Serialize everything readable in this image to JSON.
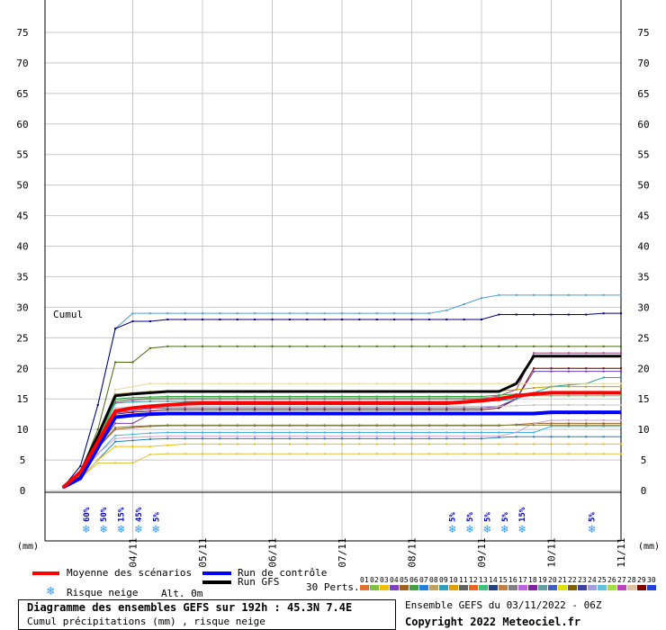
{
  "chart_data": {
    "type": "line",
    "y_tick_labels": [
      "0",
      "5",
      "10",
      "15",
      "20",
      "25",
      "30",
      "35",
      "40",
      "45",
      "50",
      "55",
      "60",
      "65",
      "70",
      "75"
    ],
    "ylim": [
      0,
      75
    ],
    "y_label_left": "(mm)",
    "y_label_right": "(mm)",
    "annotation": "Cumul",
    "x_dates": [
      "04/11",
      "05/11",
      "06/11",
      "07/11",
      "08/11",
      "09/11",
      "10/11",
      "11/11"
    ],
    "x_hours": [
      0,
      6,
      12,
      18,
      24,
      30,
      36,
      42,
      48,
      54,
      60,
      66,
      72,
      78,
      84,
      90,
      96,
      102,
      108,
      114,
      120,
      126,
      132,
      138,
      144,
      150,
      156,
      162,
      168,
      174,
      180,
      186,
      192
    ],
    "series": [
      {
        "name": "Moyenne des scénarios",
        "color": "#ff0000",
        "width": 4,
        "values": [
          0.5,
          3,
          8,
          13,
          13.5,
          13.8,
          14,
          14.2,
          14.3,
          14.3,
          14.3,
          14.3,
          14.3,
          14.3,
          14.3,
          14.3,
          14.3,
          14.3,
          14.3,
          14.3,
          14.3,
          14.3,
          14.3,
          14.5,
          14.7,
          15,
          15.5,
          15.8,
          16,
          16,
          16,
          16,
          16
        ]
      },
      {
        "name": "Run de contrôle",
        "color": "#0000ff",
        "width": 4,
        "values": [
          0.5,
          2,
          7,
          12,
          12.3,
          12.5,
          12.6,
          12.6,
          12.6,
          12.6,
          12.6,
          12.6,
          12.6,
          12.6,
          12.6,
          12.6,
          12.6,
          12.6,
          12.6,
          12.6,
          12.6,
          12.6,
          12.6,
          12.6,
          12.6,
          12.6,
          12.6,
          12.6,
          12.8,
          12.8,
          12.8,
          12.8,
          12.8
        ]
      },
      {
        "name": "Run GFS",
        "color": "#000000",
        "width": 3,
        "values": [
          0.5,
          3,
          9,
          15.5,
          15.8,
          16,
          16.2,
          16.2,
          16.2,
          16.2,
          16.2,
          16.2,
          16.2,
          16.2,
          16.2,
          16.2,
          16.2,
          16.2,
          16.2,
          16.2,
          16.2,
          16.2,
          16.2,
          16.2,
          16.2,
          16.2,
          17.5,
          22,
          22,
          22,
          22,
          22,
          22
        ]
      }
    ],
    "members": [
      {
        "color": "#4f9fd0",
        "values": [
          0.5,
          4,
          14,
          26.5,
          29,
          29,
          29,
          29,
          29,
          29,
          29,
          29,
          29,
          29,
          29,
          29,
          29,
          29,
          29,
          29,
          29,
          29,
          29.5,
          30.5,
          31.5,
          32,
          32,
          32,
          32,
          32,
          32,
          32,
          32
        ]
      },
      {
        "color": "#000080",
        "values": [
          0.5,
          4,
          14,
          26.5,
          27.7,
          27.7,
          28,
          28,
          28,
          28,
          28,
          28,
          28,
          28,
          28,
          28,
          28,
          28,
          28,
          28,
          28,
          28,
          28,
          28,
          28,
          28.8,
          28.8,
          28.8,
          28.8,
          28.8,
          28.8,
          29,
          29
        ]
      },
      {
        "color": "#4a6a10",
        "values": [
          0.5,
          3,
          10,
          21,
          21,
          23.3,
          23.6,
          23.6,
          23.6,
          23.6,
          23.6,
          23.6,
          23.6,
          23.6,
          23.6,
          23.6,
          23.6,
          23.6,
          23.6,
          23.6,
          23.6,
          23.6,
          23.6,
          23.6,
          23.6,
          23.6,
          23.6,
          23.6,
          23.6,
          23.6,
          23.6,
          23.6,
          23.6
        ]
      },
      {
        "color": "#a04080",
        "values": [
          0.5,
          3,
          9,
          14.5,
          14.8,
          15,
          15,
          15,
          15,
          15,
          15,
          15,
          15,
          15,
          15,
          15,
          15,
          15,
          15,
          15,
          15,
          15,
          15,
          15,
          15,
          15.5,
          16.5,
          22.5,
          22.5,
          22.5,
          22.5,
          22.5,
          22.5
        ]
      },
      {
        "color": "#800000",
        "values": [
          0.5,
          3,
          8,
          12.5,
          12.8,
          13,
          13.2,
          13.2,
          13.2,
          13.2,
          13.2,
          13.2,
          13.2,
          13.2,
          13.2,
          13.2,
          13.2,
          13.2,
          13.2,
          13.2,
          13.2,
          13.2,
          13.2,
          13.2,
          13.2,
          13.5,
          15,
          20,
          20,
          20,
          20,
          20,
          20
        ]
      },
      {
        "color": "#6040c0",
        "values": [
          0.5,
          3,
          8,
          12.7,
          13,
          13.4,
          13.5,
          13.5,
          13.5,
          13.5,
          13.5,
          13.5,
          13.5,
          13.5,
          13.5,
          13.5,
          13.5,
          13.5,
          13.5,
          13.5,
          13.5,
          13.5,
          13.5,
          13.5,
          13.5,
          13.8,
          15,
          19.5,
          19.5,
          19.5,
          19.5,
          19.5,
          19.5
        ]
      },
      {
        "color": "#20a0a0",
        "values": [
          0.5,
          3,
          8,
          14.3,
          14.5,
          14.6,
          14.6,
          14.6,
          14.6,
          14.6,
          14.6,
          14.6,
          14.6,
          14.6,
          14.6,
          14.6,
          14.6,
          14.6,
          14.6,
          14.6,
          14.6,
          14.6,
          14.6,
          14.6,
          14.6,
          14.7,
          15,
          16,
          17,
          17.3,
          17.5,
          18.5,
          18.5
        ]
      },
      {
        "color": "#c0a000",
        "values": [
          0.5,
          3,
          7,
          15.8,
          16,
          16.2,
          16.3,
          16.3,
          16.3,
          16.3,
          16.3,
          16.3,
          16.3,
          16.3,
          16.3,
          16.3,
          16.3,
          16.3,
          16.3,
          16.3,
          16.3,
          16.3,
          16.3,
          16.3,
          16.3,
          16.3,
          16.5,
          16.8,
          17,
          17,
          17,
          17,
          17
        ]
      },
      {
        "color": "#e8d8a0",
        "values": [
          0.5,
          3,
          8,
          16.5,
          17,
          17.5,
          17.5,
          17.5,
          17.5,
          17.5,
          17.5,
          17.5,
          17.5,
          17.5,
          17.5,
          17.5,
          17.5,
          17.5,
          17.5,
          17.5,
          17.5,
          17.5,
          17.5,
          17.5,
          17.5,
          17.5,
          17.5,
          17.5,
          17.5,
          17.5,
          17.5,
          17.5,
          17.5
        ]
      },
      {
        "color": "#30a040",
        "values": [
          0.5,
          3,
          8,
          15,
          15.2,
          15.3,
          15.4,
          15.4,
          15.4,
          15.4,
          15.4,
          15.4,
          15.4,
          15.4,
          15.4,
          15.4,
          15.4,
          15.4,
          15.4,
          15.4,
          15.4,
          15.4,
          15.4,
          15.4,
          15.4,
          15.6,
          15.8,
          15.8,
          15.8,
          15.8,
          15.8,
          15.8,
          15.8
        ]
      },
      {
        "color": "#60c060",
        "values": [
          0.5,
          3,
          8,
          14.8,
          15,
          15.1,
          15.2,
          15.2,
          15.2,
          15.2,
          15.2,
          15.2,
          15.2,
          15.2,
          15.2,
          15.2,
          15.2,
          15.2,
          15.2,
          15.2,
          15.2,
          15.2,
          15.2,
          15.2,
          15.2,
          15.3,
          15.5,
          15.5,
          15.5,
          15.5,
          15.5,
          15.5,
          15.5
        ]
      },
      {
        "color": "#c0c0c0",
        "values": [
          0.5,
          3,
          8,
          13.5,
          13.7,
          13.8,
          13.8,
          13.8,
          13.8,
          13.8,
          13.8,
          13.8,
          13.8,
          13.8,
          13.8,
          13.8,
          13.8,
          13.8,
          13.8,
          13.8,
          13.8,
          13.8,
          13.8,
          13.8,
          13.8,
          13.8,
          13.9,
          14,
          14,
          14,
          14,
          14,
          14
        ]
      },
      {
        "color": "#a06020",
        "values": [
          0.5,
          2.5,
          7,
          10,
          10.3,
          10.5,
          10.6,
          10.6,
          10.6,
          10.6,
          10.6,
          10.6,
          10.6,
          10.6,
          10.6,
          10.6,
          10.6,
          10.6,
          10.6,
          10.6,
          10.6,
          10.6,
          10.6,
          10.6,
          10.6,
          10.6,
          10.8,
          11,
          11,
          11,
          11,
          11,
          11
        ]
      },
      {
        "color": "#8040a0",
        "values": [
          0.5,
          2.5,
          7,
          11,
          11,
          12.5,
          12.6,
          12.6,
          12.6,
          12.6,
          12.6,
          12.6,
          12.6,
          12.6,
          12.6,
          12.6,
          12.6,
          12.6,
          12.6,
          12.6,
          12.6,
          12.6,
          12.6,
          12.6,
          12.6,
          12.6,
          12.6,
          12.6,
          12.6,
          12.6,
          12.6,
          12.6,
          12.6
        ]
      },
      {
        "color": "#40b0e0",
        "values": [
          0.5,
          2.5,
          6,
          9,
          9.2,
          9.4,
          9.5,
          9.5,
          9.5,
          9.5,
          9.5,
          9.5,
          9.5,
          9.5,
          9.5,
          9.5,
          9.5,
          9.5,
          9.5,
          9.5,
          9.5,
          9.5,
          9.5,
          9.5,
          9.5,
          9.5,
          9.5,
          9.5,
          10.5,
          10.5,
          10.5,
          10.5,
          10.5
        ]
      },
      {
        "color": "#d0a0d0",
        "values": [
          0.5,
          2.5,
          6,
          8.5,
          8.7,
          8.8,
          8.9,
          8.9,
          8.9,
          8.9,
          8.9,
          8.9,
          8.9,
          8.9,
          8.9,
          8.9,
          8.9,
          8.9,
          8.9,
          8.9,
          8.9,
          8.9,
          8.9,
          8.9,
          8.9,
          8.9,
          9.5,
          11,
          11.5,
          11.5,
          11.5,
          11.5,
          11.5
        ]
      },
      {
        "color": "#2080c0",
        "values": [
          0.5,
          2,
          5,
          8,
          8.2,
          8.4,
          8.5,
          8.5,
          8.5,
          8.5,
          8.5,
          8.5,
          8.5,
          8.5,
          8.5,
          8.5,
          8.5,
          8.5,
          8.5,
          8.5,
          8.5,
          8.5,
          8.5,
          8.5,
          8.5,
          8.7,
          8.8,
          8.8,
          8.8,
          8.8,
          8.8,
          8.8,
          8.8
        ]
      },
      {
        "color": "#f0c000",
        "values": [
          0.5,
          2,
          5,
          7.2,
          7.2,
          7.2,
          7.4,
          7.6,
          7.6,
          7.6,
          7.6,
          7.6,
          7.6,
          7.6,
          7.6,
          7.6,
          7.6,
          7.6,
          7.6,
          7.6,
          7.6,
          7.6,
          7.6,
          7.6,
          7.6,
          7.6,
          7.6,
          7.6,
          7.6,
          7.6,
          7.6,
          7.6,
          7.6
        ]
      },
      {
        "color": "#e0c040",
        "values": [
          0.5,
          2,
          4.5,
          4.5,
          4.5,
          5.9,
          6,
          6,
          6,
          6,
          6,
          6,
          6,
          6,
          6,
          6,
          6,
          6,
          6,
          6,
          6,
          6,
          6,
          6,
          6,
          6,
          6,
          6,
          6,
          6,
          6,
          6,
          6
        ]
      },
      {
        "color": "#808040",
        "values": [
          0.5,
          2.5,
          7,
          10.3,
          10.5,
          10.6,
          10.7,
          10.7,
          10.7,
          10.7,
          10.7,
          10.7,
          10.7,
          10.7,
          10.7,
          10.7,
          10.7,
          10.7,
          10.7,
          10.7,
          10.7,
          10.7,
          10.7,
          10.7,
          10.7,
          10.7,
          10.7,
          10.7,
          10.7,
          10.7,
          10.7,
          10.7,
          10.7
        ]
      }
    ],
    "snow_markers": [
      {
        "date_hour": 8,
        "pct": "60%"
      },
      {
        "date_hour": 14,
        "pct": "50%"
      },
      {
        "date_hour": 20,
        "pct": "15%"
      },
      {
        "date_hour": 26,
        "pct": "45%"
      },
      {
        "date_hour": 32,
        "pct": "5%"
      },
      {
        "date_hour": 134,
        "pct": "5%"
      },
      {
        "date_hour": 140,
        "pct": "5%"
      },
      {
        "date_hour": 146,
        "pct": "5%"
      },
      {
        "date_hour": 152,
        "pct": "5%"
      },
      {
        "date_hour": 158,
        "pct": "15%"
      },
      {
        "date_hour": 182,
        "pct": "5%"
      }
    ]
  },
  "legend": {
    "mean_label": "Moyenne des scénarios",
    "control_label": "Run de contrôle",
    "gfs_label": "Run GFS",
    "snow_label": "Risque neige",
    "alt_label": "Alt. 0m",
    "perts_label": "30 Perts.",
    "member_numbers": [
      "01",
      "02",
      "03",
      "04",
      "05",
      "06",
      "07",
      "08",
      "09",
      "10",
      "11",
      "12",
      "13",
      "14",
      "15",
      "16",
      "17",
      "18",
      "19",
      "20",
      "21",
      "22",
      "23",
      "24",
      "25",
      "26",
      "27",
      "28",
      "29",
      "30"
    ],
    "member_colors": [
      "#e07030",
      "#80c040",
      "#f0c000",
      "#8040c0",
      "#a06020",
      "#40a040",
      "#2080e0",
      "#c0a060",
      "#30a0c0",
      "#e0a000",
      "#606060",
      "#f06020",
      "#40c080",
      "#204080",
      "#c08040",
      "#808080",
      "#c060e0",
      "#8020a0",
      "#60a0a0",
      "#4060c0",
      "#e0e000",
      "#806000",
      "#4040a0",
      "#a0a0e0",
      "#60c0e0",
      "#a0e040",
      "#c040c0",
      "#e0c0a0",
      "#800000",
      "#2040e0"
    ]
  },
  "footer": {
    "title": "Diagramme des ensembles GEFS sur 192h : 45.3N 7.4E",
    "subtitle": "Cumul précipitations (mm) , risque neige",
    "run": "Ensemble GEFS du 03/11/2022 - 06Z",
    "copyright": "Copyright 2022 Meteociel.fr"
  }
}
